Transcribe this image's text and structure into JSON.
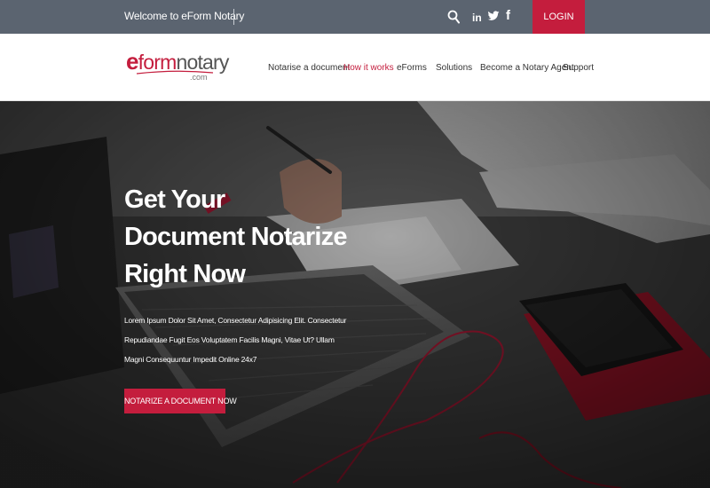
{
  "topbar": {
    "welcome": "Welcome to eForm Notary",
    "icons": [
      "search-icon",
      "linkedin-icon",
      "twitter-icon",
      "facebook-icon"
    ],
    "linkedin_glyph": "in",
    "facebook_glyph": "f",
    "login_label": "LOGIN"
  },
  "logo": {
    "e": "e",
    "form": "form",
    "notary": "notary",
    "com": ".com"
  },
  "nav": {
    "items": [
      {
        "label": "Notarise a document"
      },
      {
        "label": "How it works"
      },
      {
        "label": "eForms"
      },
      {
        "label": "Solutions"
      },
      {
        "label": "Become a Notary Agent"
      },
      {
        "label": "Support"
      }
    ],
    "active_item": "How it works"
  },
  "hero": {
    "title_lines": [
      "Get Your",
      "Document Notarize",
      "Right Now"
    ],
    "description": "Lorem Ipsum Dolor Sit Amet, Consectetur Adipisicing Elit. Consectetur Repudiandae Fugit Eos Voluptatem Facilis Magni, Vitae Ut? Ullam Magni Consequuntur Impedit Online 24x7",
    "cta_label": "NOTARIZE A DOCUMENT NOW"
  },
  "colors": {
    "accent": "#c41d3d",
    "topbar": "#5b6470"
  }
}
